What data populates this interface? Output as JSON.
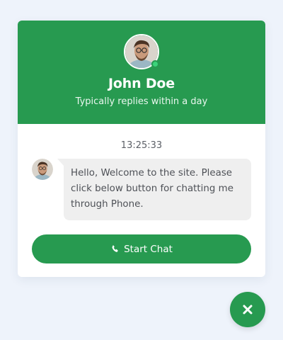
{
  "agent": {
    "name": "John Doe",
    "status": "Typically replies within a day",
    "avatar_icon": "avatar-photo",
    "online": true
  },
  "conversation": {
    "time": "13:25:33",
    "message": "Hello, Welcome to the site. Please click below button for chatting me through Phone."
  },
  "actions": {
    "start_chat_label": "Start Chat",
    "start_chat_icon": "phone-icon",
    "close_icon": "close-icon"
  },
  "colors": {
    "brand_green": "#279a50",
    "online_dot": "#3bd37a",
    "bubble_bg": "#efefef",
    "page_bg": "#eef3fb"
  }
}
